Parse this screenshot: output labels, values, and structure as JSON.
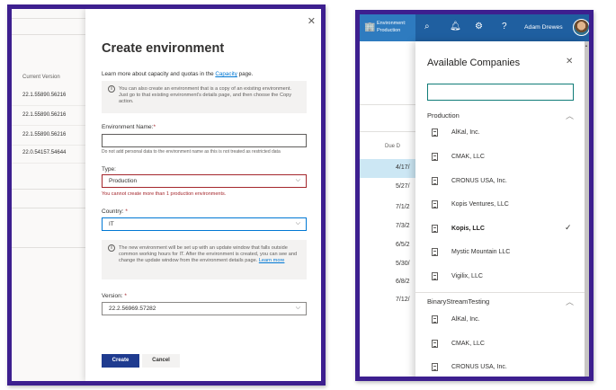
{
  "left": {
    "background": {
      "column_header": "Current Version",
      "versions": [
        "22.1.55890.56216",
        "22.1.55890.56216",
        "22.1.55890.56216",
        "22.0.54157.54644"
      ]
    },
    "panel": {
      "title": "Create environment",
      "intro_prefix": "Learn more about capacity and quotas in the ",
      "intro_link": "Capacity",
      "intro_suffix": " page.",
      "copy_info": "You can also create an environment that is a copy of an existing environment. Just go to that existing environment's details page, and then choose the Copy action.",
      "name_label": "Environment Name:",
      "name_value": "",
      "name_hint": "Do not add personal data to the environment name as this is not treated as restricted data",
      "type_label": "Type:",
      "type_value": "Production",
      "type_error": "You cannot create more than 1 production environments.",
      "country_label": "Country:",
      "country_value": "IT",
      "update_info": "The new environment will be set up with an update window that falls outside common working hours for IT. After the environment is created, you can see and change the update window from the environment details page.",
      "update_link": "Learn more",
      "version_label": "Version:",
      "version_value": "22.2.56969.57282",
      "create_label": "Create",
      "cancel_label": "Cancel",
      "required_mark": "*"
    }
  },
  "right": {
    "topbar": {
      "env_line1": "Environment:",
      "env_line2": "Production",
      "user_name": "Adam Drewes"
    },
    "background": {
      "column_header": "Due D",
      "dates": [
        "4/17/",
        "5/27/",
        "7/1/2",
        "7/3/2",
        "6/5/2",
        "5/30/",
        "6/8/2",
        "7/12/"
      ],
      "selected_index": 0
    },
    "companies": {
      "title": "Available Companies",
      "search_value": "",
      "groups": [
        {
          "name": "Production",
          "items": [
            {
              "name": "AlKal, Inc.",
              "selected": false
            },
            {
              "name": "CMAK, LLC",
              "selected": false
            },
            {
              "name": "CRONUS USA, Inc.",
              "selected": false
            },
            {
              "name": "Kopis Ventures, LLC",
              "selected": false
            },
            {
              "name": "Kopis, LLC",
              "selected": true
            },
            {
              "name": "Mystic Mountain LLC",
              "selected": false
            },
            {
              "name": "Vigilix, LLC",
              "selected": false
            }
          ]
        },
        {
          "name": "BinaryStreamTesting",
          "items": [
            {
              "name": "AlKal, Inc.",
              "selected": false
            },
            {
              "name": "CMAK, LLC",
              "selected": false
            },
            {
              "name": "CRONUS USA, Inc.",
              "selected": false
            }
          ]
        }
      ]
    },
    "icons": [
      "building-icon",
      "search-icon",
      "bell-icon",
      "gear-icon",
      "help-icon",
      "avatar"
    ]
  }
}
